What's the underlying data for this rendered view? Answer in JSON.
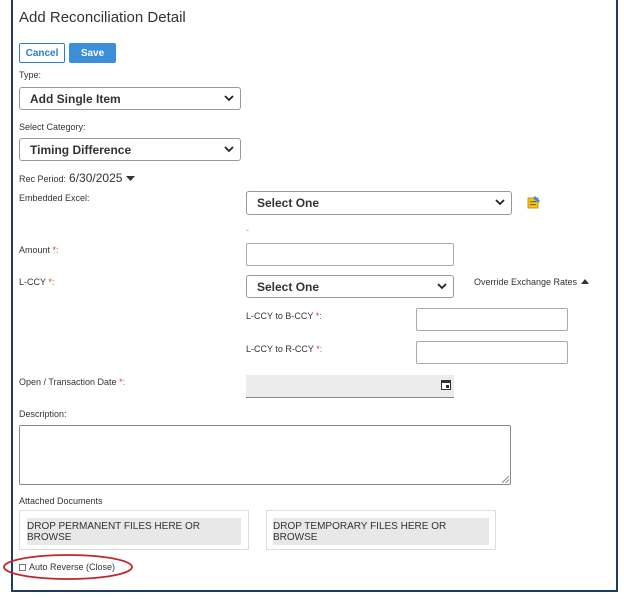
{
  "form": {
    "title": "Add Reconciliation Detail",
    "cancel_label": "Cancel",
    "save_label": "Save",
    "type_label": "Type:",
    "type_value": "Add Single Item",
    "category_label": "Select Category:",
    "category_value": "Timing Difference",
    "rec_period_label": "Rec Period:",
    "rec_period_value": "6/30/2025",
    "embedded_excel_label": "Embedded Excel:",
    "embedded_excel_value": "Select One",
    "dash_text": "-",
    "amount_label": "Amount",
    "amount_value": "",
    "lccy_label": "L-CCY",
    "lccy_value": "Select One",
    "override_label": "Override Exchange Rates",
    "lccy_to_bccy_label": "L-CCY to B-CCY",
    "lccy_to_rccy_label": "L-CCY to R-CCY",
    "open_date_label": "Open / Transaction Date",
    "description_label": "Description:",
    "attached_docs_label": "Attached Documents",
    "drop_permanent_label": "DROP PERMANENT FILES HERE OR BROWSE",
    "drop_temporary_label": "DROP TEMPORARY FILES HERE OR BROWSE",
    "auto_reverse_label": "Auto Reverse (Close)",
    "required_mark": "*:"
  },
  "colors": {
    "primary": "#3a8fd8",
    "required": "#e03a2a",
    "frame": "#1f3a63",
    "highlight_ellipse": "#c0262d"
  }
}
